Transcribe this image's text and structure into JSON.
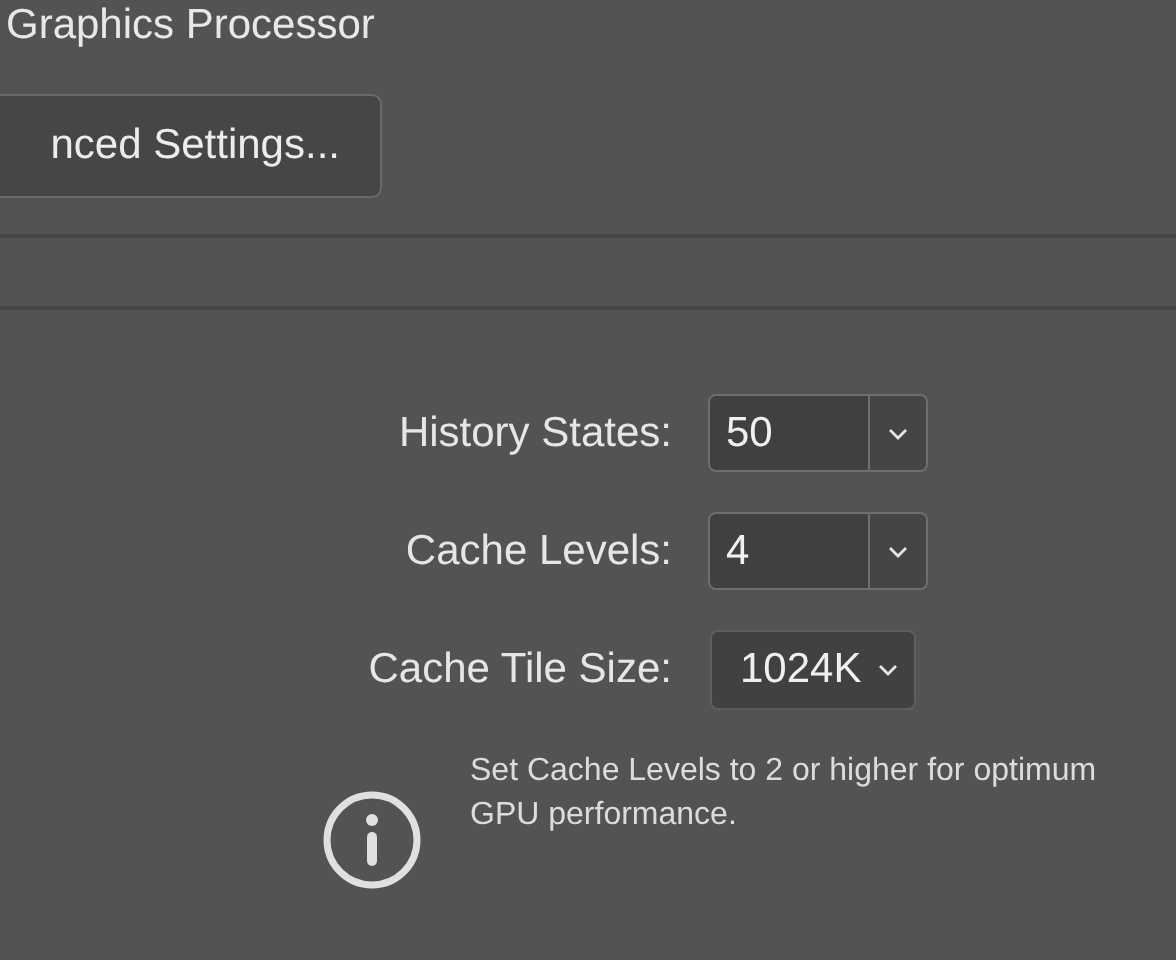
{
  "section_title": "Graphics Processor",
  "settings_button": "nced Settings...",
  "fields": [
    {
      "label": "History States:",
      "value": "50",
      "kind": "combo"
    },
    {
      "label": "Cache Levels:",
      "value": "4",
      "kind": "combo"
    },
    {
      "label": "Cache Tile Size:",
      "value": "1024K",
      "kind": "select"
    }
  ],
  "info_note": "Set Cache Levels to 2 or higher for optimum GPU performance."
}
